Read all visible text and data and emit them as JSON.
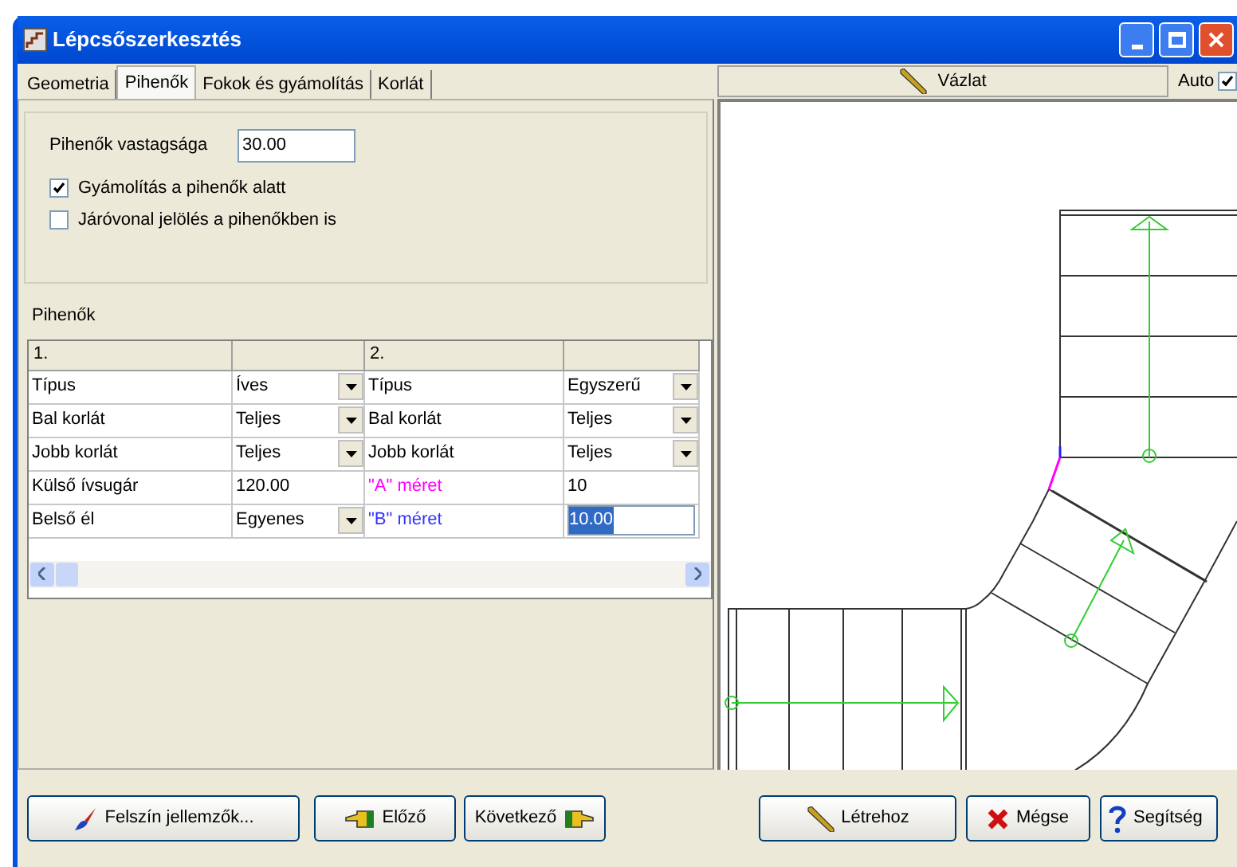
{
  "window": {
    "title": "Lépcsőszerkesztés"
  },
  "tabs": [
    {
      "label": "Geometria",
      "selected": false
    },
    {
      "label": "Pihenők",
      "selected": true
    },
    {
      "label": "Fokok és gyámolítás",
      "selected": false
    },
    {
      "label": "Korlát",
      "selected": false
    }
  ],
  "sketch_button": {
    "label": "Vázlat"
  },
  "auto": {
    "label": "Auto",
    "checked": true
  },
  "thickness": {
    "label": "Pihenők vastagsága",
    "value": "30.00"
  },
  "options": [
    {
      "label": "Gyámolítás a pihenők alatt",
      "checked": true
    },
    {
      "label": "Járóvonal jelölés a pihenőkben is",
      "checked": false
    }
  ],
  "landings": {
    "label": "Pihenők",
    "columns": [
      "1.",
      "",
      "2.",
      ""
    ],
    "rows": [
      {
        "cells": [
          {
            "kind": "text",
            "text": "Típus"
          },
          {
            "kind": "combo",
            "text": "Íves"
          },
          {
            "kind": "text",
            "text": "Típus"
          },
          {
            "kind": "combo",
            "text": "Egyszerű"
          }
        ]
      },
      {
        "cells": [
          {
            "kind": "text",
            "text": "Bal korlát"
          },
          {
            "kind": "combo",
            "text": "Teljes"
          },
          {
            "kind": "text",
            "text": "Bal korlát"
          },
          {
            "kind": "combo",
            "text": "Teljes"
          }
        ]
      },
      {
        "cells": [
          {
            "kind": "text",
            "text": "Jobb korlát"
          },
          {
            "kind": "combo",
            "text": "Teljes"
          },
          {
            "kind": "text",
            "text": "Jobb korlát"
          },
          {
            "kind": "combo",
            "text": "Teljes"
          }
        ]
      },
      {
        "cells": [
          {
            "kind": "text",
            "text": "Külső ívsugár"
          },
          {
            "kind": "text",
            "text": "120.00"
          },
          {
            "kind": "text",
            "text": "\"A\" méret",
            "color": "#ff00ff"
          },
          {
            "kind": "text",
            "text": "10"
          }
        ]
      },
      {
        "cells": [
          {
            "kind": "text",
            "text": "Belső él"
          },
          {
            "kind": "combo",
            "text": "Egyenes"
          },
          {
            "kind": "text",
            "text": "\"B\" méret",
            "color": "#3333ff"
          },
          {
            "kind": "edit",
            "text": "10.00",
            "selected": true
          }
        ]
      }
    ]
  },
  "buttons_left": [
    {
      "label": "Felszín jellemzők..."
    },
    {
      "label": "Előző"
    },
    {
      "label": "Következő"
    }
  ],
  "buttons_right": [
    {
      "label": "Létrehoz"
    },
    {
      "label": "Mégse"
    },
    {
      "label": "Segítség"
    }
  ]
}
